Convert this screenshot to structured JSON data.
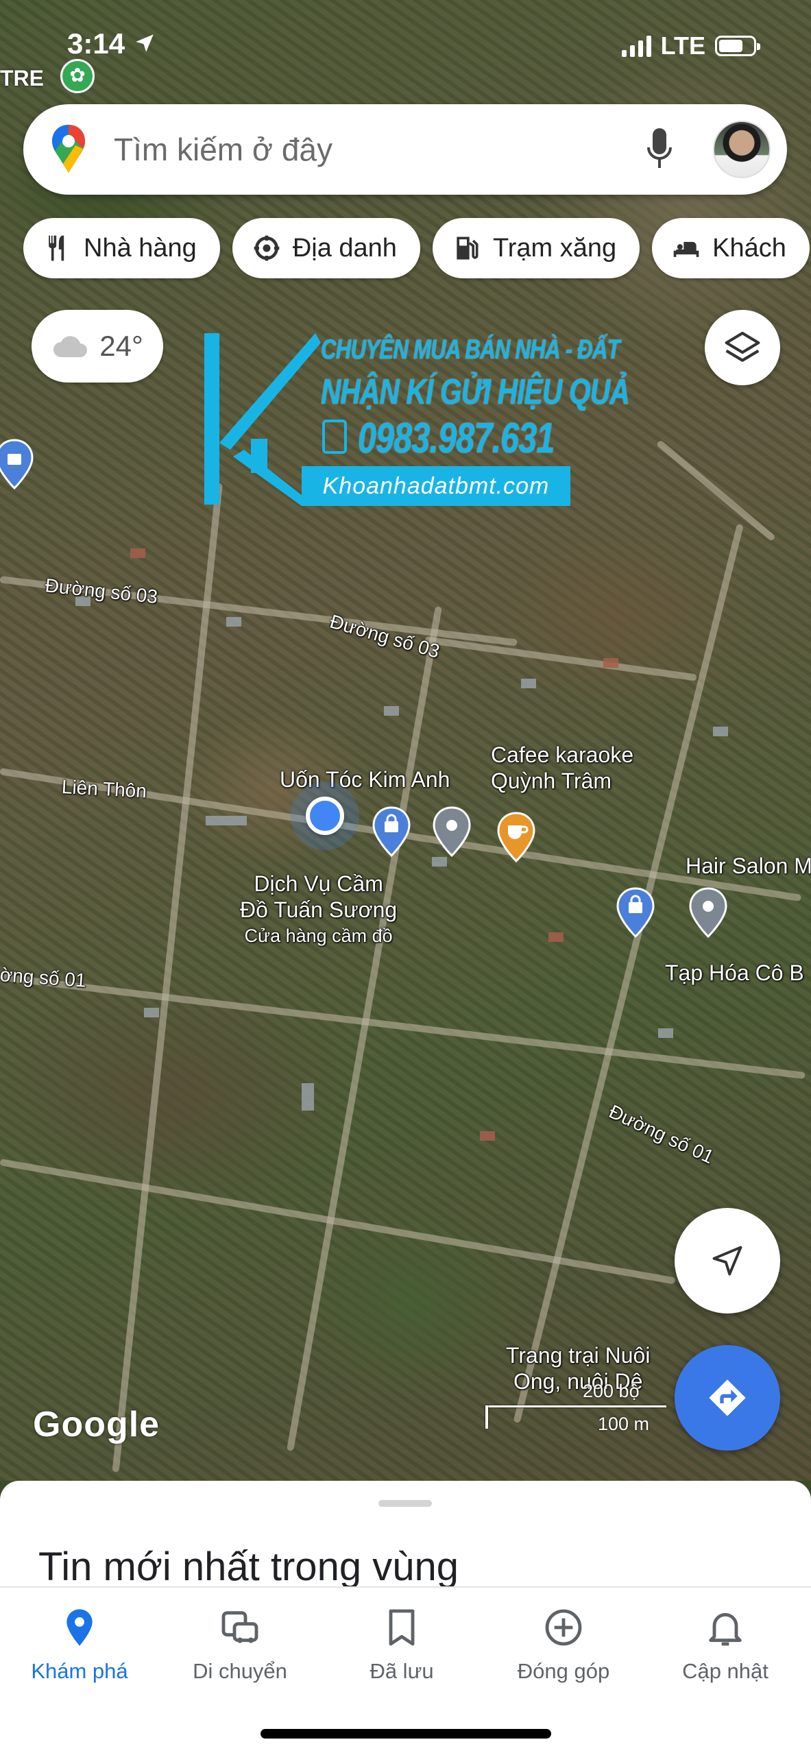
{
  "status_bar": {
    "time": "3:14",
    "network": "LTE"
  },
  "search": {
    "placeholder": "Tìm kiếm ở đây"
  },
  "chips": [
    {
      "label": "Nhà hàng",
      "icon": "restaurant-icon"
    },
    {
      "label": "Địa danh",
      "icon": "landmark-icon"
    },
    {
      "label": "Trạm xăng",
      "icon": "gas-station-icon"
    },
    {
      "label": "Khách",
      "icon": "hotel-icon"
    }
  ],
  "weather": {
    "temperature": "24°",
    "icon": "cloud-icon"
  },
  "watermark": {
    "line1": "CHUYÊN MUA BÁN NHÀ - ĐẤT",
    "line2": "NHẬN KÍ GỬI HIỆU QUẢ",
    "line3": "0983.987.631",
    "url": "Khoanhadatbmt.com"
  },
  "map": {
    "top_left_poi": "TRE",
    "streets": [
      "Đường số 03",
      "Đường số 03",
      "Liên Thôn",
      "ờng số 01",
      "Đường số 01"
    ],
    "places": {
      "hair_kim_anh": "Uốn Tóc Kim Anh",
      "cafe_line1": "Cafee karaoke",
      "cafe_line2": "Quỳnh Trâm",
      "pawn_line1": "Dịch Vụ Cầm",
      "pawn_line2": "Đồ Tuấn Sương",
      "pawn_sub": "Cửa hàng cầm đồ",
      "hair_salon": "Hair Salon M",
      "grocery": "Tạp Hóa Cô B",
      "farm_line1": "Trang trại Nuôi",
      "farm_line2": "Ong, nuôi Dê"
    },
    "scale_ft": "200 bộ",
    "scale_m": "100 m",
    "logo": "Google"
  },
  "sheet": {
    "title": "Tin mới nhất trong vùng"
  },
  "nav": [
    {
      "label": "Khám phá",
      "icon": "explore-pin-icon",
      "active": true
    },
    {
      "label": "Di chuyển",
      "icon": "commute-icon",
      "active": false
    },
    {
      "label": "Đã lưu",
      "icon": "bookmark-icon",
      "active": false
    },
    {
      "label": "Đóng góp",
      "icon": "add-circle-icon",
      "active": false
    },
    {
      "label": "Cập nhật",
      "icon": "bell-icon",
      "active": false
    }
  ]
}
